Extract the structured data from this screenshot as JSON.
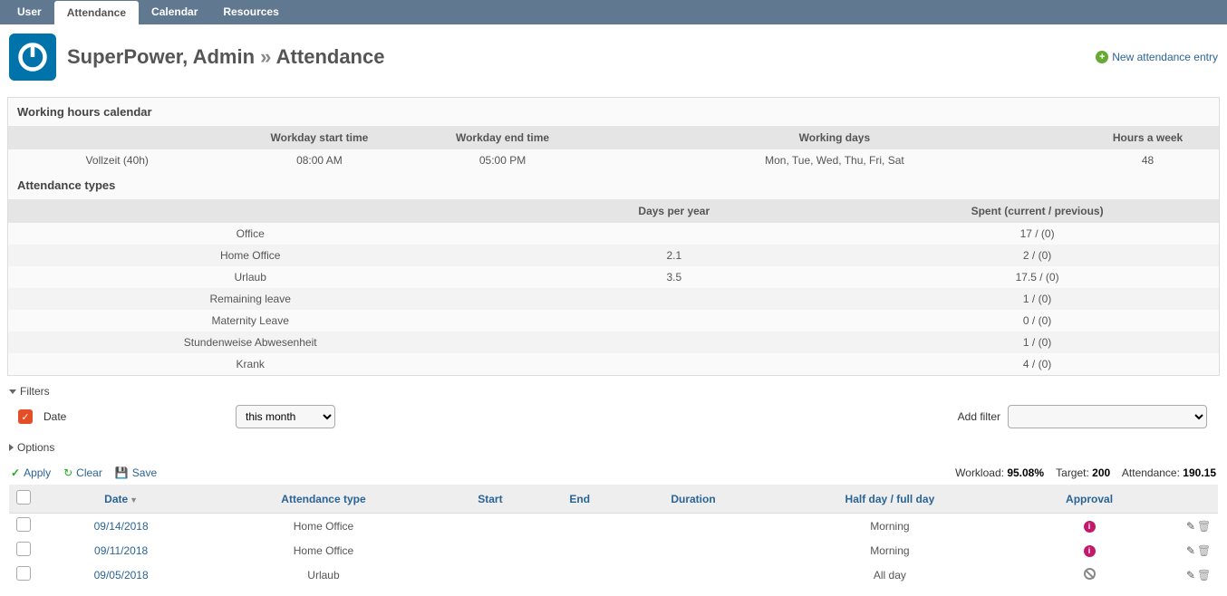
{
  "nav": {
    "tabs": [
      "User",
      "Attendance",
      "Calendar",
      "Resources"
    ],
    "active": 1
  },
  "header": {
    "title_name": "SuperPower, Admin",
    "title_page": "Attendance",
    "new_entry_label": "New attendance entry"
  },
  "calendar": {
    "section_title": "Working hours calendar",
    "headers": [
      "",
      "Workday start time",
      "Workday end time",
      "Working days",
      "Hours a week"
    ],
    "row": {
      "name": "Vollzeit (40h)",
      "start": "08:00 AM",
      "end": "05:00 PM",
      "days": "Mon, Tue, Wed, Thu, Fri, Sat",
      "hours": "48"
    }
  },
  "types": {
    "section_title": "Attendance types",
    "headers": [
      "",
      "Days per year",
      "Spent (current / previous)"
    ],
    "rows": [
      {
        "name": "Office",
        "dpy": "",
        "spent": "17 / (0)"
      },
      {
        "name": "Home Office",
        "dpy": "2.1",
        "spent": "2 / (0)"
      },
      {
        "name": "Urlaub",
        "dpy": "3.5",
        "spent": "17.5 / (0)"
      },
      {
        "name": "Remaining leave",
        "dpy": "",
        "spent": "1 / (0)"
      },
      {
        "name": "Maternity Leave",
        "dpy": "",
        "spent": "0 / (0)"
      },
      {
        "name": "Stundenweise Abwesenheit",
        "dpy": "",
        "spent": "1 / (0)"
      },
      {
        "name": "Krank",
        "dpy": "",
        "spent": "4 / (0)"
      }
    ]
  },
  "filter_section": {
    "filters_label": "Filters",
    "options_label": "Options",
    "date_label": "Date",
    "date_selected": "this month",
    "add_filter_label": "Add filter"
  },
  "actions": {
    "apply": "Apply",
    "clear": "Clear",
    "save": "Save"
  },
  "stats": {
    "workload_label": "Workload:",
    "workload_value": "95.08%",
    "target_label": "Target:",
    "target_value": "200",
    "attendance_label": "Attendance:",
    "attendance_value": "190.15"
  },
  "entries": {
    "headers": {
      "date": "Date",
      "type": "Attendance type",
      "start": "Start",
      "end": "End",
      "duration": "Duration",
      "halfday": "Half day / full day",
      "approval": "Approval"
    },
    "rows": [
      {
        "date": "09/14/2018",
        "type": "Home Office",
        "start": "",
        "end": "",
        "duration": "",
        "halfday": "Morning",
        "approval": "pending"
      },
      {
        "date": "09/11/2018",
        "type": "Home Office",
        "start": "",
        "end": "",
        "duration": "",
        "halfday": "Morning",
        "approval": "pending"
      },
      {
        "date": "09/05/2018",
        "type": "Urlaub",
        "start": "",
        "end": "",
        "duration": "",
        "halfday": "All day",
        "approval": "denied"
      }
    ]
  }
}
